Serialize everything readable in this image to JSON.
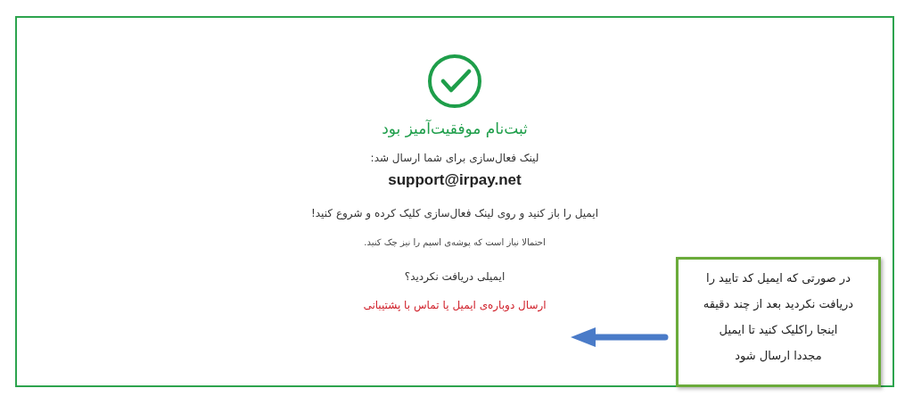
{
  "status": {
    "kind": "success",
    "title": "ثبت‌نام موفقیت‌آمیز بود"
  },
  "message": "لینک فعال‌سازی برای شما ارسال شد:",
  "email": "support@irpay.net",
  "instruction": "ایمیل را باز کنید و روی لینک فعال‌سازی کلیک کرده و شروع کنید!",
  "note": "احتمالا نیاز است که پوشه‌ی اسپم را نیز چک کنید.",
  "question": "ایمیلی دریافت نکردید؟",
  "resend_link": "ارسال دوباره‌ی ایمیل",
  "separator": "یا",
  "support_link": "تماس با پشتیبانی",
  "callout": {
    "lines": [
      "در صورتی که ایمیل کد تایید را",
      "دریافت نکردید بعد از چند دقیقه",
      "اینجا راکلیک کنید تا ایمیل",
      "مجددا ارسال شود"
    ]
  }
}
